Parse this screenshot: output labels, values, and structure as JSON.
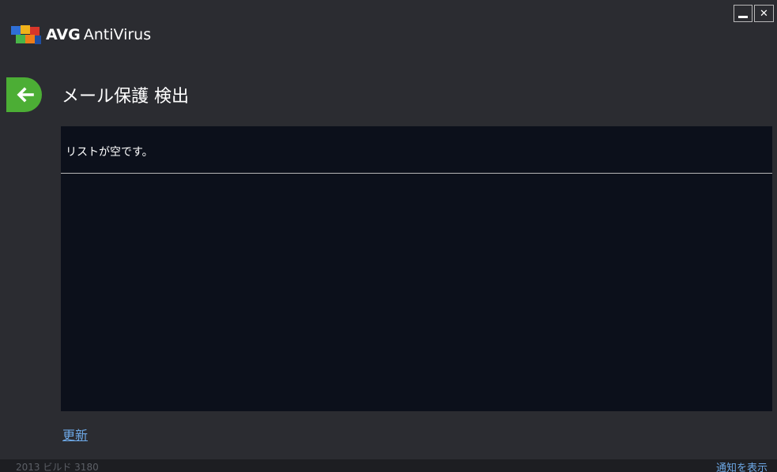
{
  "window": {
    "brand": "AVG",
    "product": "AntiVirus",
    "minimize_icon": "minimize-icon",
    "close_icon": "close-icon"
  },
  "header": {
    "back_icon": "back-arrow-icon",
    "title": "メール保護 検出"
  },
  "list": {
    "empty_message": "リストが空です。"
  },
  "actions": {
    "refresh_label": "更新"
  },
  "status_bar": {
    "build": "2013 ビルド 3180",
    "notifications_label": "通知を表示"
  },
  "colors": {
    "background": "#2b2c31",
    "panel": "#0c101b",
    "accent_green": "#4cae35",
    "link": "#6da8e6"
  }
}
